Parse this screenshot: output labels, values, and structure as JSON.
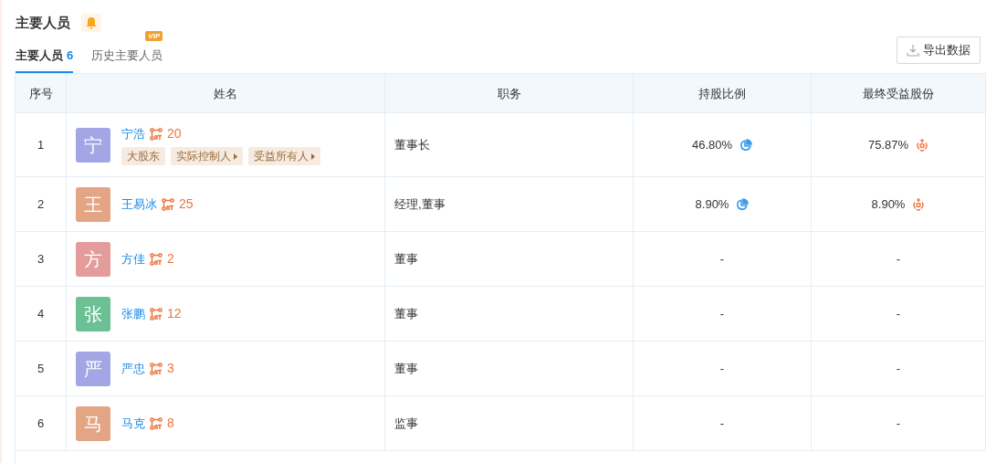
{
  "section": {
    "title": "主要人员"
  },
  "tabs": [
    {
      "label": "主要人员",
      "count": "6",
      "selected": true
    },
    {
      "label": "历史主要人员",
      "badge": "VIP",
      "selected": false
    }
  ],
  "export_button": {
    "label": "导出数据"
  },
  "table": {
    "columns": [
      "序号",
      "姓名",
      "职务",
      "持股比例",
      "最终受益股份"
    ],
    "rows": [
      {
        "index": "1",
        "avatar": "宁",
        "color": "#a3a6e4",
        "name": "宁浩",
        "links": "20",
        "tags": [
          {
            "label": "大股东",
            "arrow": false
          },
          {
            "label": "实际控制人",
            "arrow": true
          },
          {
            "label": "受益所有人",
            "arrow": true
          }
        ],
        "position": "董事长",
        "shareholding": {
          "text": "46.80%",
          "icon": true
        },
        "beneficial": {
          "text": "75.87%",
          "icon": true
        }
      },
      {
        "index": "2",
        "avatar": "王",
        "color": "#e4a585",
        "name": "王易冰",
        "links": "25",
        "tags": [],
        "position": "经理,董事",
        "shareholding": {
          "text": "8.90%",
          "icon": true
        },
        "beneficial": {
          "text": "8.90%",
          "icon": true
        }
      },
      {
        "index": "3",
        "avatar": "方",
        "color": "#e39b9b",
        "name": "方佳",
        "links": "2",
        "tags": [],
        "position": "董事",
        "shareholding": {
          "text": "-",
          "icon": false
        },
        "beneficial": {
          "text": "-",
          "icon": false
        }
      },
      {
        "index": "4",
        "avatar": "张",
        "color": "#6dbf94",
        "name": "张鹏",
        "links": "12",
        "tags": [],
        "position": "董事",
        "shareholding": {
          "text": "-",
          "icon": false
        },
        "beneficial": {
          "text": "-",
          "icon": false
        }
      },
      {
        "index": "5",
        "avatar": "严",
        "color": "#a3a6e4",
        "name": "严忠",
        "links": "3",
        "tags": [],
        "position": "董事",
        "shareholding": {
          "text": "-",
          "icon": false
        },
        "beneficial": {
          "text": "-",
          "icon": false
        }
      },
      {
        "index": "6",
        "avatar": "马",
        "color": "#e4a585",
        "name": "马克",
        "links": "8",
        "tags": [],
        "position": "监事",
        "shareholding": {
          "text": "-",
          "icon": false
        },
        "beneficial": {
          "text": "-",
          "icon": false
        }
      }
    ]
  }
}
